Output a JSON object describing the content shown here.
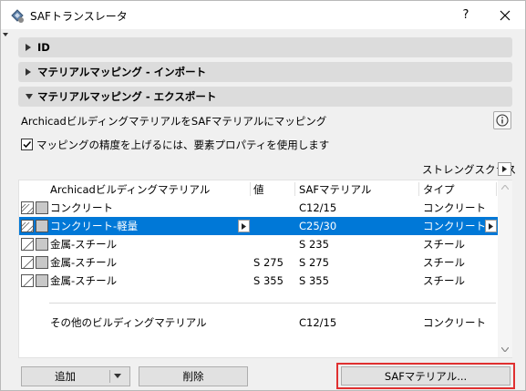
{
  "window": {
    "title": "SAFトランスレータ",
    "help_label": "?"
  },
  "sections": [
    {
      "label": "ID",
      "expanded": false
    },
    {
      "label": "マテリアルマッピング - インポート",
      "expanded": false
    },
    {
      "label": "マテリアルマッピング - エクスポート",
      "expanded": true
    }
  ],
  "export": {
    "intro_text": "ArchicadビルディングマテリアルをSAFマテリアルにマッピング",
    "checkbox_label": "マッピングの精度を上げるには、要素プロパティを使用します",
    "checkbox_checked": true,
    "strength_class_label": "ストレングスクラス"
  },
  "table": {
    "columns": [
      "Archicadビルディングマテリアル",
      "値",
      "SAFマテリアル",
      "タイプ"
    ],
    "rows": [
      {
        "material": "コンクリート",
        "value": "",
        "saf": "C12/15",
        "type": "コンクリート",
        "selected": false,
        "pattern": "concrete"
      },
      {
        "material": "コンクリート-軽量",
        "value": "",
        "saf": "C25/30",
        "type": "コンクリート",
        "selected": true,
        "pattern": "concrete"
      },
      {
        "material": "金属-スチール",
        "value": "",
        "saf": "S 235",
        "type": "スチール",
        "selected": false,
        "pattern": "steel"
      },
      {
        "material": "金属-スチール",
        "value": "S 275",
        "saf": "S 275",
        "type": "スチール",
        "selected": false,
        "pattern": "steel"
      },
      {
        "material": "金属-スチール",
        "value": "S 355",
        "saf": "S 355",
        "type": "スチール",
        "selected": false,
        "pattern": "steel"
      }
    ],
    "other_row": {
      "material": "その他のビルディングマテリアル",
      "saf": "C12/15",
      "type": "コンクリート"
    }
  },
  "buttons": {
    "add": "追加",
    "delete": "削除",
    "saf_material": "SAFマテリアル..."
  },
  "colors": {
    "selection": "#0078d7",
    "highlight_border": "#e03030"
  }
}
